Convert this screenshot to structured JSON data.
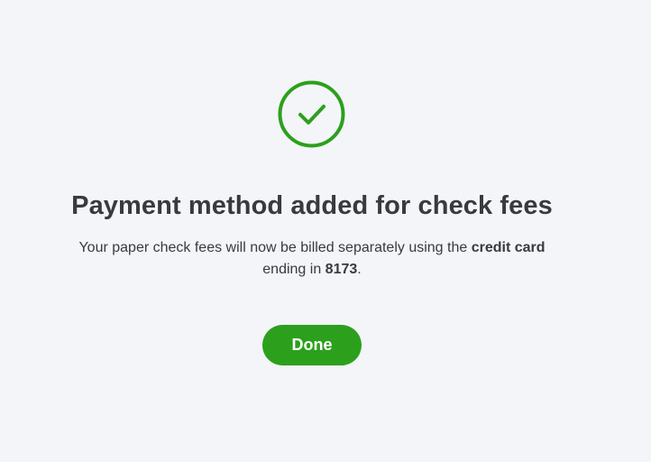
{
  "dialog": {
    "icon": "checkmark-circle-icon",
    "title": "Payment method added for check fees",
    "message": {
      "part1": "Your paper check fees will now be billed separately using the ",
      "card_type": "credit card",
      "part2": " ending in ",
      "card_last4": "8173",
      "part3": "."
    },
    "done_label": "Done"
  },
  "colors": {
    "accent": "#2ca01c",
    "background": "#f3f5f9",
    "text": "#393a3d"
  }
}
